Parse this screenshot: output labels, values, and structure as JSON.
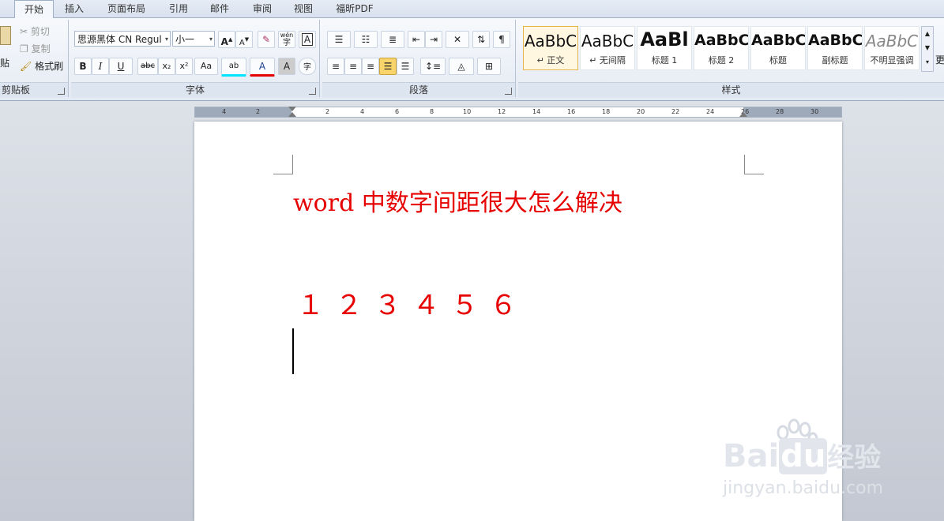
{
  "tabs": [
    "开始",
    "插入",
    "页面布局",
    "引用",
    "邮件",
    "审阅",
    "视图",
    "福昕PDF"
  ],
  "clipboard": {
    "paste_label": "贴",
    "cut_label": "剪切",
    "copy_label": "复制",
    "format_painter_label": "格式刷",
    "group_label": "剪贴板"
  },
  "font": {
    "font_name": "思源黑体 CN Regul",
    "font_size": "小一",
    "group_label": "字体",
    "grow_label": "A",
    "shrink_label": "A",
    "phonetic_label": "wén",
    "bold": "B",
    "italic": "I",
    "underline": "U",
    "strike": "abc",
    "sub": "x₂",
    "sup": "x²",
    "case": "Aa",
    "highlight": "ab",
    "color": "A",
    "shade": "A",
    "enclose": "字",
    "border_char": "A"
  },
  "paragraph": {
    "group_label": "段落"
  },
  "styles": {
    "group_label": "样式",
    "items": [
      {
        "sample": "AaBbC",
        "name": "↵ 正文"
      },
      {
        "sample": "AaBbC",
        "name": "↵ 无间隔"
      },
      {
        "sample": "AaBl",
        "name": "标题 1"
      },
      {
        "sample": "AaBbC",
        "name": "标题 2"
      },
      {
        "sample": "AaBbC",
        "name": "标题"
      },
      {
        "sample": "AaBbC",
        "name": "副标题"
      },
      {
        "sample": "AaBbC",
        "name": "不明显强调"
      }
    ],
    "more_label": "更"
  },
  "ruler_numbers": [
    "4",
    "2",
    "2",
    "4",
    "6",
    "8",
    "10",
    "12",
    "14",
    "16",
    "18",
    "20",
    "22",
    "24",
    "26",
    "28",
    "30"
  ],
  "document": {
    "title": "word 中数字间距很大怎么解决",
    "numbers": "１ ２ ３ ４ ５ ６"
  },
  "watermark": {
    "brand_left": "Bai",
    "brand_mid": "du",
    "brand_right": "经验",
    "url": "jingyan.baidu.com"
  },
  "colors": {
    "doc_text": "#e60000",
    "ribbon_bg": "#e4eaf3"
  }
}
